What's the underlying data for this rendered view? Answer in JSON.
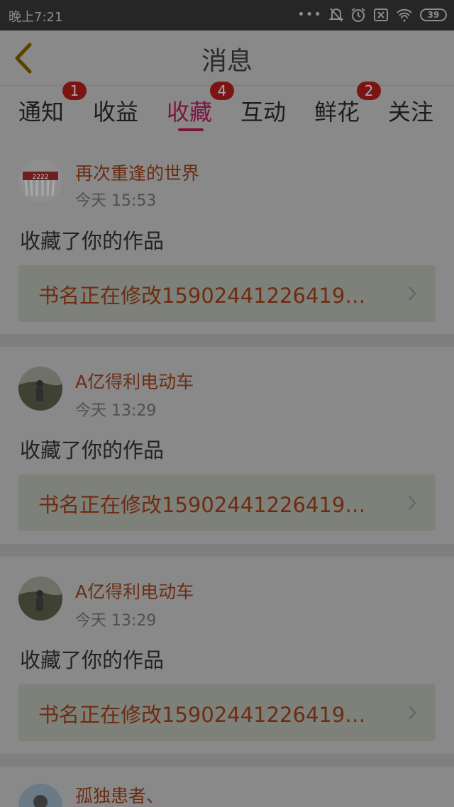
{
  "status_bar": {
    "time": "晚上7:21",
    "dots": "•••",
    "battery": "39",
    "icons": [
      "bell-muted-icon",
      "alarm-icon",
      "sim-off-icon",
      "wifi-icon",
      "battery-icon"
    ]
  },
  "nav": {
    "title": "消息",
    "back_icon": "chevron-left-icon"
  },
  "tabs": [
    {
      "label": "通知",
      "badge": "1"
    },
    {
      "label": "收益",
      "badge": ""
    },
    {
      "label": "收藏",
      "badge": "4",
      "active": true
    },
    {
      "label": "互动",
      "badge": ""
    },
    {
      "label": "鲜花",
      "badge": "2"
    },
    {
      "label": "关注",
      "badge": ""
    }
  ],
  "messages": [
    {
      "name": "再次重逢的世界",
      "time": "今天 15:53",
      "action": "收藏了你的作品",
      "work_title": "书名正在修改1590244122641​9…"
    },
    {
      "name": "A亿得利电动车",
      "time": "今天 13:29",
      "action": "收藏了你的作品",
      "work_title": "书名正在修改1590244122641​9…"
    },
    {
      "name": "A亿得利电动车",
      "time": "今天 13:29",
      "action": "收藏了你的作品",
      "work_title": "书名正在修改1590244122641​9…"
    },
    {
      "name": "孤独患者、",
      "time": "",
      "action": "",
      "work_title": ""
    }
  ],
  "colors": {
    "accent": "#7a1640",
    "badge": "#7c1414",
    "name": "#6a2d12",
    "overlay_bg": "#898989"
  }
}
